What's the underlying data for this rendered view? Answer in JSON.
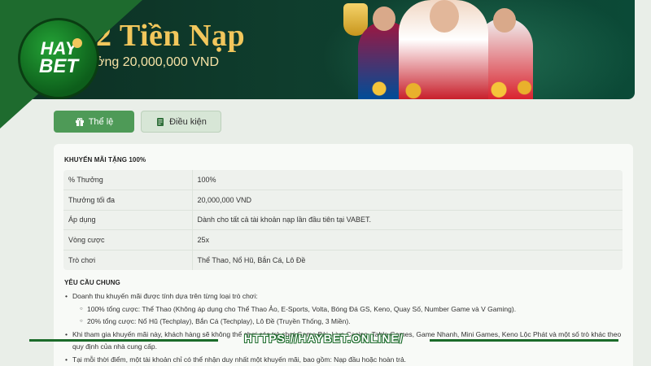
{
  "banner": {
    "title": "2 Tiền Nạp",
    "subtitle": "ởng 20,000,000 VND"
  },
  "logo": {
    "top_text": "HAY",
    "bottom_text": "BET",
    "brand_color": "#1e6b2e"
  },
  "tabs": [
    {
      "label": "Thể lệ",
      "icon": "gift-icon",
      "active": true
    },
    {
      "label": "Điều kiện",
      "icon": "document-icon",
      "active": false
    }
  ],
  "promo": {
    "title": "KHUYẾN MÃI TẶNG 100%",
    "rows": [
      {
        "key": "% Thưởng",
        "value": "100%"
      },
      {
        "key": "Thưởng tối đa",
        "value": "20,000,000 VND"
      },
      {
        "key": "Áp dụng",
        "value": "Dành cho tất cả tài khoản nạp lần đầu tiên tại VABET."
      },
      {
        "key": "Vòng cược",
        "value": "25x"
      },
      {
        "key": "Trò chơi",
        "value": "Thể Thao, Nổ Hũ, Bắn Cá, Lô Đề"
      }
    ]
  },
  "requirements": {
    "title": "YÊU CẦU CHUNG",
    "intro": "Doanh thu khuyến mãi được tính dựa trên từng loại trò chơi:",
    "sub": [
      "100% tổng cược: Thể Thao (Không áp dụng cho Thể Thao Ảo, E-Sports, Volta, Bóng Đá GS, Keno, Quay Số, Number Game và V Gaming).",
      "20% tổng cược: Nổ Hũ (Techplay), Bắn Cá (Techplay), Lô Đề (Truyền Thống, 3 Miền)."
    ],
    "item2": "Khi tham gia khuyến mãi này, khách hàng sẽ không thể chơi các trò chơi Game Bài, Live Casino, Table Games, Game Nhanh, Mini Games, Keno Lộc Phát và một số trò khác theo quy định của nhà cung cấp.",
    "item3": "Tại mỗi thời điểm, một tài khoản chỉ có thể nhận duy nhất một khuyến mãi, bao gồm: Nạp đầu hoặc hoàn trả."
  },
  "watermark": {
    "text": "HTTPS://HAYBET.ONLINE/"
  }
}
